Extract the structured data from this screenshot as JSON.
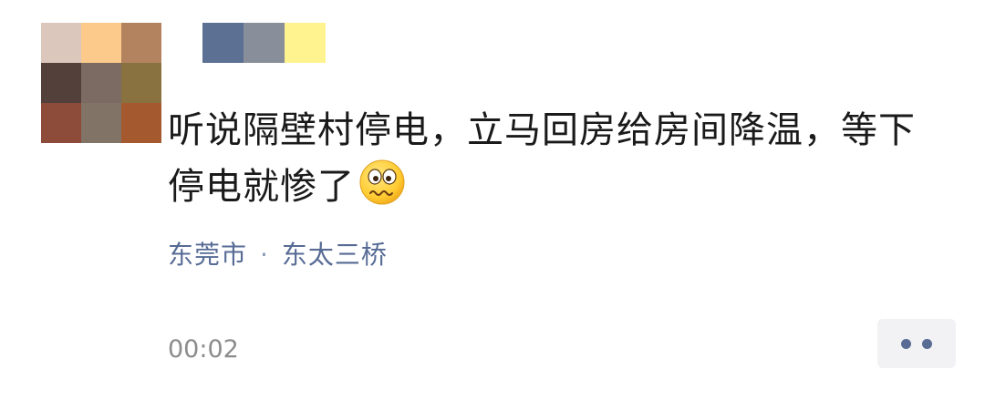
{
  "post": {
    "content": "听说隔壁村停电，立马回房给房间降温，等下停电就惨了",
    "emoji": "woozy-face-emoji",
    "location": {
      "city": "东莞市",
      "separator": "·",
      "place": "东太三桥"
    },
    "time": "00:02"
  },
  "avatar": {
    "pixel_colors": [
      "#dcc7bd",
      "#fcca8a",
      "#b38360",
      "#53403a",
      "#7b6b62",
      "#8a7240",
      "#8d4c3a",
      "#817467",
      "#a45a2e"
    ]
  },
  "username": {
    "pixel_colors": [
      "#5c7093",
      "#898e9b",
      "#fff390"
    ]
  },
  "colors": {
    "link": "#576b95",
    "text": "#1a1a1a",
    "muted": "#8c8c8c"
  },
  "more_button": {
    "icon": "more-dots-icon"
  }
}
